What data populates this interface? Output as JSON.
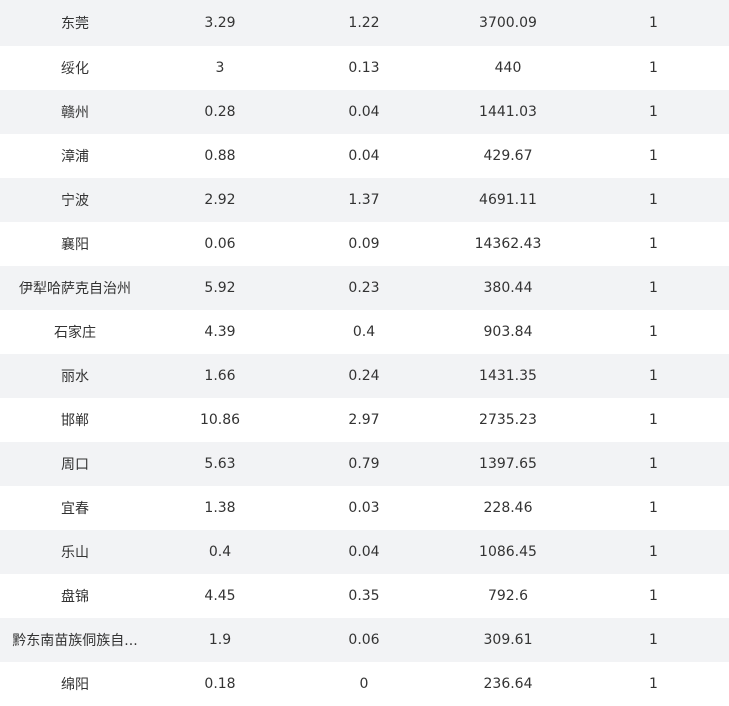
{
  "table": {
    "rows": [
      {
        "city": "东莞",
        "v1": "3.29",
        "v2": "1.22",
        "v3": "3700.09",
        "v4": "1"
      },
      {
        "city": "绥化",
        "v1": "3",
        "v2": "0.13",
        "v3": "440",
        "v4": "1"
      },
      {
        "city": "赣州",
        "v1": "0.28",
        "v2": "0.04",
        "v3": "1441.03",
        "v4": "1"
      },
      {
        "city": "漳浦",
        "v1": "0.88",
        "v2": "0.04",
        "v3": "429.67",
        "v4": "1"
      },
      {
        "city": "宁波",
        "v1": "2.92",
        "v2": "1.37",
        "v3": "4691.11",
        "v4": "1"
      },
      {
        "city": "襄阳",
        "v1": "0.06",
        "v2": "0.09",
        "v3": "14362.43",
        "v4": "1"
      },
      {
        "city": "伊犁哈萨克自治州",
        "v1": "5.92",
        "v2": "0.23",
        "v3": "380.44",
        "v4": "1"
      },
      {
        "city": "石家庄",
        "v1": "4.39",
        "v2": "0.4",
        "v3": "903.84",
        "v4": "1"
      },
      {
        "city": "丽水",
        "v1": "1.66",
        "v2": "0.24",
        "v3": "1431.35",
        "v4": "1"
      },
      {
        "city": "邯郸",
        "v1": "10.86",
        "v2": "2.97",
        "v3": "2735.23",
        "v4": "1"
      },
      {
        "city": "周口",
        "v1": "5.63",
        "v2": "0.79",
        "v3": "1397.65",
        "v4": "1"
      },
      {
        "city": "宜春",
        "v1": "1.38",
        "v2": "0.03",
        "v3": "228.46",
        "v4": "1"
      },
      {
        "city": "乐山",
        "v1": "0.4",
        "v2": "0.04",
        "v3": "1086.45",
        "v4": "1"
      },
      {
        "city": "盘锦",
        "v1": "4.45",
        "v2": "0.35",
        "v3": "792.6",
        "v4": "1"
      },
      {
        "city": "黔东南苗族侗族自...",
        "v1": "1.9",
        "v2": "0.06",
        "v3": "309.61",
        "v4": "1"
      },
      {
        "city": "绵阳",
        "v1": "0.18",
        "v2": "0",
        "v3": "236.64",
        "v4": "1"
      }
    ]
  }
}
